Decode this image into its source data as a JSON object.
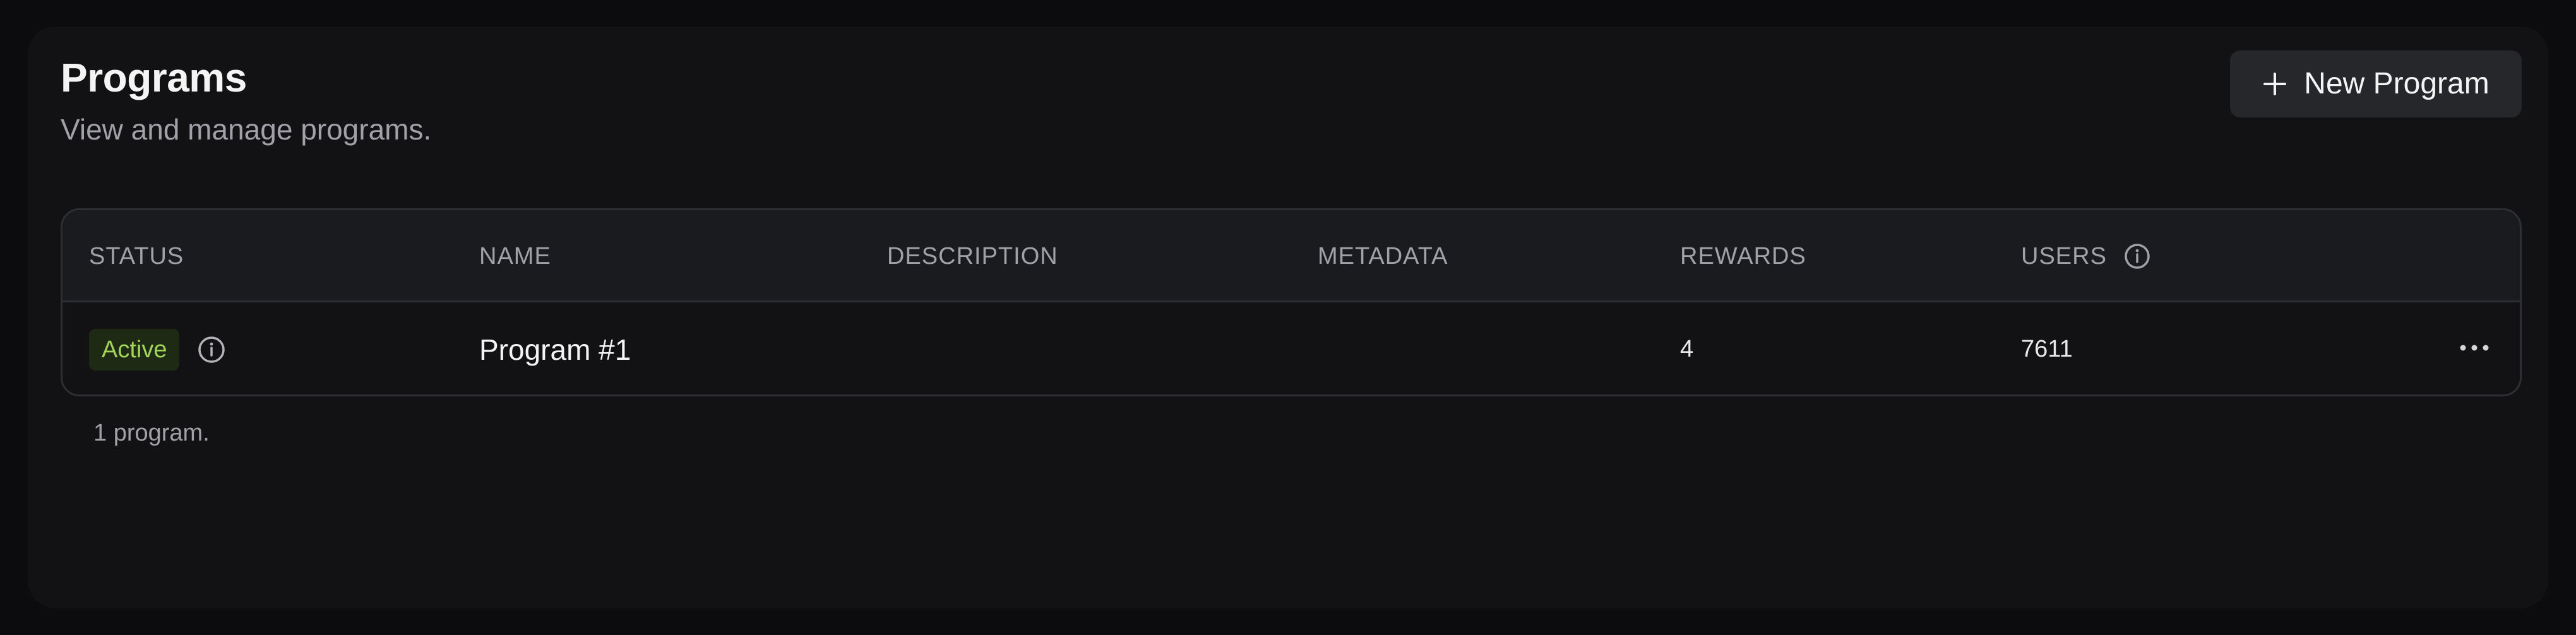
{
  "header": {
    "title": "Programs",
    "subtitle": "View and manage programs."
  },
  "actions": {
    "new_program_label": "New Program",
    "new_program_icon": "plus-icon"
  },
  "table": {
    "columns": {
      "status": "STATUS",
      "name": "NAME",
      "description": "DESCRIPTION",
      "metadata": "METADATA",
      "rewards": "REWARDS",
      "users": "USERS"
    },
    "users_header_icon": "info-icon",
    "rows": [
      {
        "status": "Active",
        "status_icon": "info-icon",
        "name": "Program #1",
        "description": "",
        "metadata": "",
        "rewards": "4",
        "users": "7611",
        "menu_icon": "more-horizontal-icon"
      }
    ]
  },
  "footer": {
    "count_text": "1 program."
  },
  "colors": {
    "background": "#0c0c0e",
    "panel": "#121214",
    "header_row": "#1a1b1e",
    "border": "#2e2f34",
    "button": "#26272b",
    "status_active_bg": "#1e2a14",
    "status_active_text": "#a3d45a",
    "muted_text": "#a1a1a8"
  }
}
